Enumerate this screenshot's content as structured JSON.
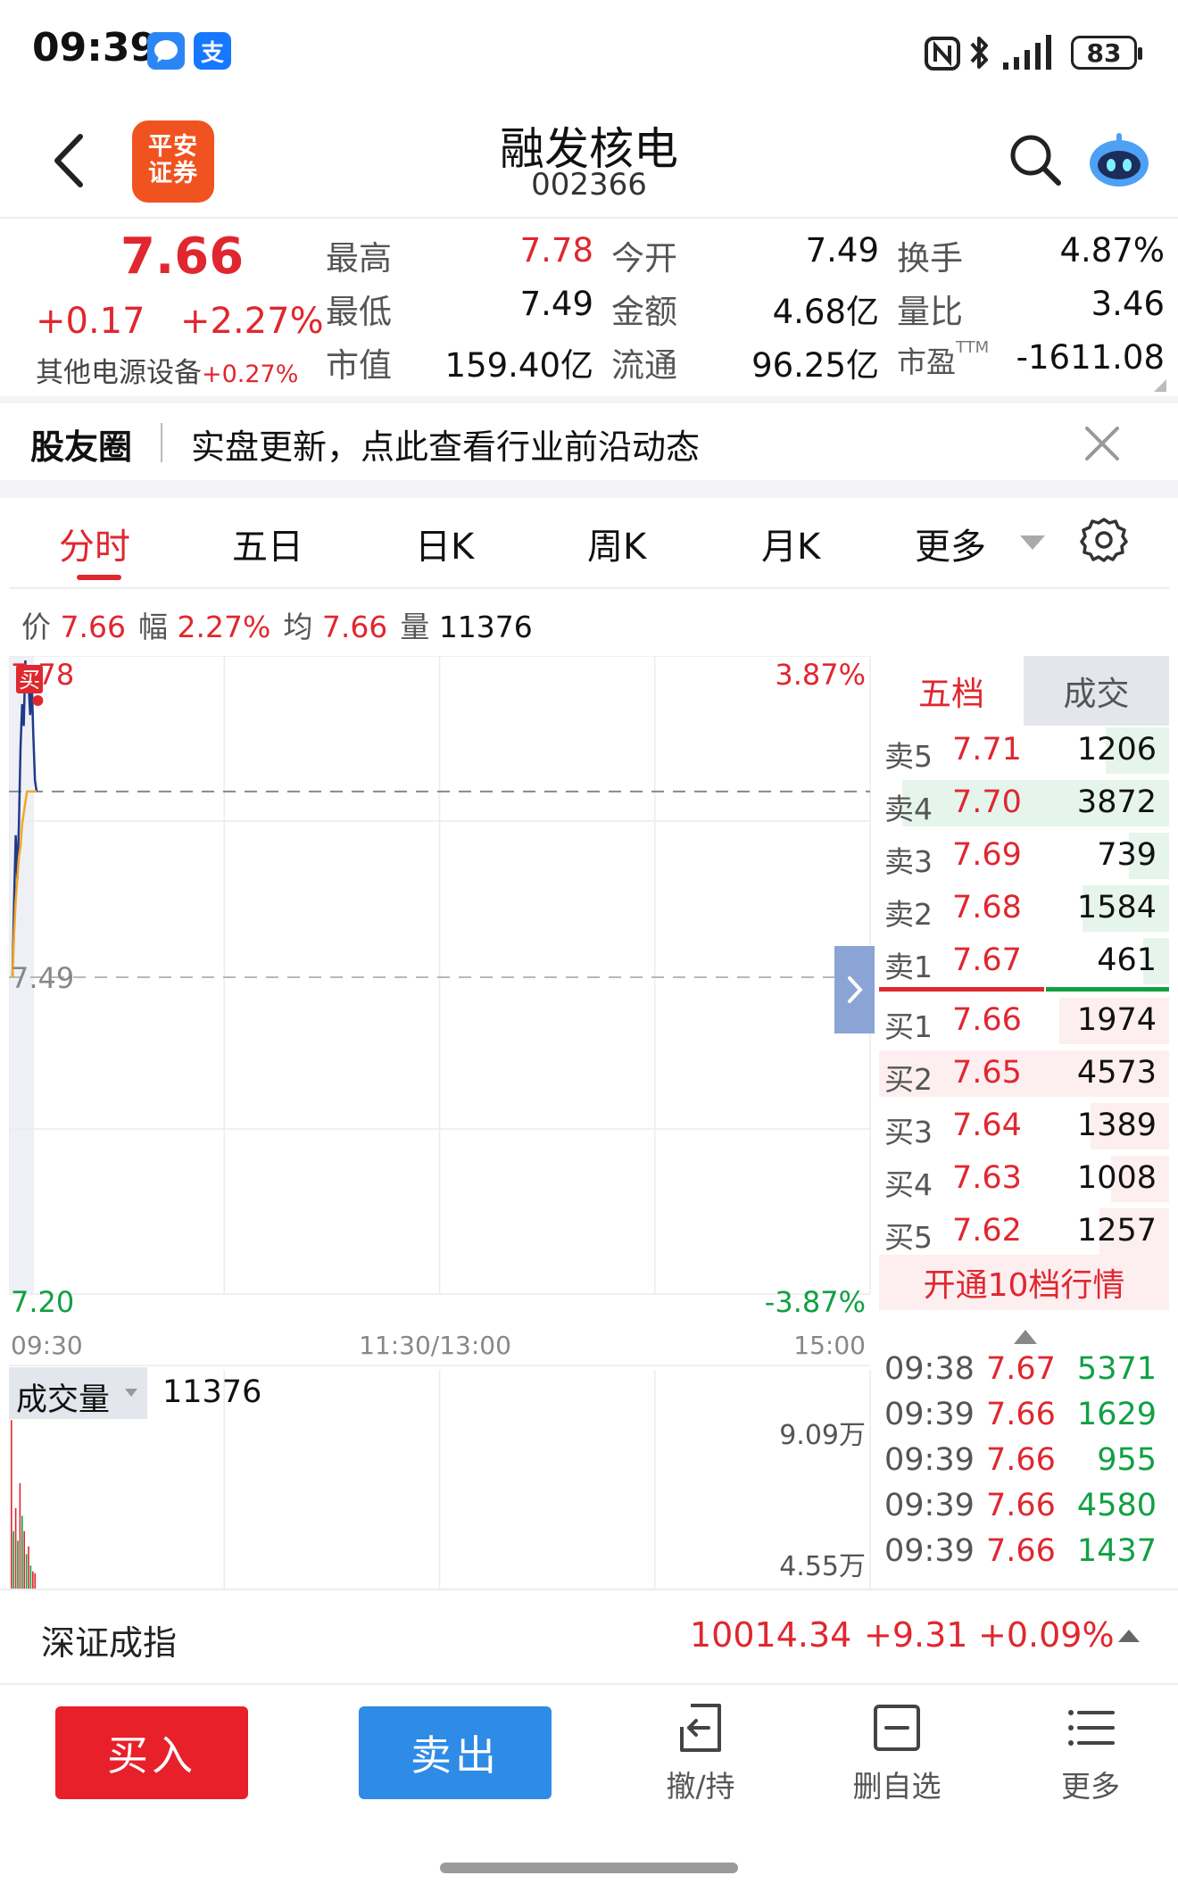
{
  "status_bar": {
    "time": "09:39",
    "apps": [
      {
        "icon": "message-icon",
        "glyph": "💬",
        "color": "#2b86f5"
      },
      {
        "icon": "alipay-icon",
        "glyph": "支",
        "color": "#1677ff"
      }
    ],
    "battery": "83"
  },
  "header": {
    "broker_logo": "平安证券",
    "stock_name": "融发核电",
    "stock_code": "002366"
  },
  "quote": {
    "price": "7.66",
    "change": "+0.17",
    "change_pct": "+2.27%",
    "sector": "其他电源设备",
    "sector_pct": "+0.27%",
    "rows": [
      [
        {
          "label": "最高",
          "value": "7.78",
          "color": "red"
        },
        {
          "label": "今开",
          "value": "7.49"
        },
        {
          "label": "换手",
          "value": "4.87%"
        }
      ],
      [
        {
          "label": "最低",
          "value": "7.49"
        },
        {
          "label": "金额",
          "value": "4.68亿"
        },
        {
          "label": "量比",
          "value": "3.46"
        }
      ],
      [
        {
          "label": "市值",
          "value": "159.40亿"
        },
        {
          "label": "流通",
          "value": "96.25亿"
        },
        {
          "label": "市盈",
          "sup": "TTM",
          "value": "-1611.08"
        }
      ]
    ]
  },
  "banner": {
    "title": "股友圈",
    "text": "实盘更新，点此查看行业前沿动态"
  },
  "tabs": [
    {
      "label": "分时",
      "active": true
    },
    {
      "label": "五日"
    },
    {
      "label": "日K"
    },
    {
      "label": "周K"
    },
    {
      "label": "月K"
    },
    {
      "label": "更多"
    }
  ],
  "info_line": {
    "price_label": "价",
    "price": "7.66",
    "pct_label": "幅",
    "pct": "2.27%",
    "avg_label": "均",
    "avg": "7.66",
    "vol_label": "量",
    "vol": "11376"
  },
  "chart_data": {
    "type": "line",
    "title": "",
    "y_top_label": "7.78",
    "y_mid_label": "7.49",
    "y_bottom_label": "7.20",
    "pct_top": "3.87%",
    "pct_bottom": "-3.87%",
    "x_labels": [
      "09:30",
      "11:30/13:00",
      "15:00"
    ],
    "buy_marker": "买",
    "ylim": [
      7.2,
      7.78
    ],
    "prev_close": 7.49,
    "series": [
      {
        "color": "#1f3a8a",
        "values": [
          7.49,
          7.56,
          7.62,
          7.58,
          7.63,
          7.7,
          7.74,
          7.72,
          7.78,
          7.75,
          7.76,
          7.73,
          7.76,
          7.71,
          7.67,
          7.66
        ]
      },
      {
        "color": "#f5a623",
        "values": [
          7.49,
          7.53,
          7.56,
          7.58,
          7.6,
          7.61,
          7.63,
          7.64,
          7.65,
          7.66,
          7.66,
          7.66,
          7.66,
          7.66,
          7.66,
          7.66
        ]
      }
    ],
    "avg_line_value": 7.66,
    "volume": {
      "label": "成交量",
      "value": "11376",
      "scale_labels": [
        "9.09万",
        "4.55万"
      ],
      "max": 90900,
      "bars": [
        {
          "v": 88000,
          "c": "red"
        },
        {
          "v": 30000,
          "c": "green"
        },
        {
          "v": 42000,
          "c": "red"
        },
        {
          "v": 25000,
          "c": "green"
        },
        {
          "v": 55000,
          "c": "red"
        },
        {
          "v": 38000,
          "c": "green"
        },
        {
          "v": 30000,
          "c": "red"
        },
        {
          "v": 18000,
          "c": "green"
        },
        {
          "v": 22000,
          "c": "red"
        },
        {
          "v": 12000,
          "c": "green"
        },
        {
          "v": 9000,
          "c": "red"
        },
        {
          "v": 8000,
          "c": "red"
        }
      ]
    }
  },
  "order_book": {
    "tab_five": "五档",
    "tab_trades": "成交",
    "asks": [
      {
        "label": "卖5",
        "price": "7.71",
        "vol": "1206",
        "bar": 0.22
      },
      {
        "label": "卖4",
        "price": "7.70",
        "vol": "3872",
        "bar": 0.92
      },
      {
        "label": "卖3",
        "price": "7.69",
        "vol": "739",
        "bar": 0.14
      },
      {
        "label": "卖2",
        "price": "7.68",
        "vol": "1584",
        "bar": 0.3
      },
      {
        "label": "卖1",
        "price": "7.67",
        "vol": "461",
        "bar": 0.09
      }
    ],
    "bids": [
      {
        "label": "买1",
        "price": "7.66",
        "vol": "1974",
        "bar": 0.38
      },
      {
        "label": "买2",
        "price": "7.65",
        "vol": "4573",
        "bar": 1.0
      },
      {
        "label": "买3",
        "price": "7.64",
        "vol": "1389",
        "bar": 0.27
      },
      {
        "label": "买4",
        "price": "7.63",
        "vol": "1008",
        "bar": 0.2
      },
      {
        "label": "买5",
        "price": "7.62",
        "vol": "1257",
        "bar": 0.24
      }
    ],
    "open_10": "开通10档行情"
  },
  "trades": [
    {
      "time": "09:38",
      "price": "7.67",
      "qty": "5371"
    },
    {
      "time": "09:39",
      "price": "7.66",
      "qty": "1629"
    },
    {
      "time": "09:39",
      "price": "7.66",
      "qty": "955"
    },
    {
      "time": "09:39",
      "price": "7.66",
      "qty": "4580"
    },
    {
      "time": "09:39",
      "price": "7.66",
      "qty": "1437"
    }
  ],
  "index_bar": {
    "name": "深证成指",
    "value": "10014.34",
    "change": "+9.31",
    "pct": "+0.09%"
  },
  "toolbar": {
    "buy": "买入",
    "sell": "卖出",
    "cancel": "撤/持",
    "remove_watch": "删自选",
    "more": "更多"
  },
  "colors": {
    "up": "#e0272f",
    "down": "#11a043",
    "buy_button": "#e8202a",
    "sell_button": "#2e8be6"
  }
}
